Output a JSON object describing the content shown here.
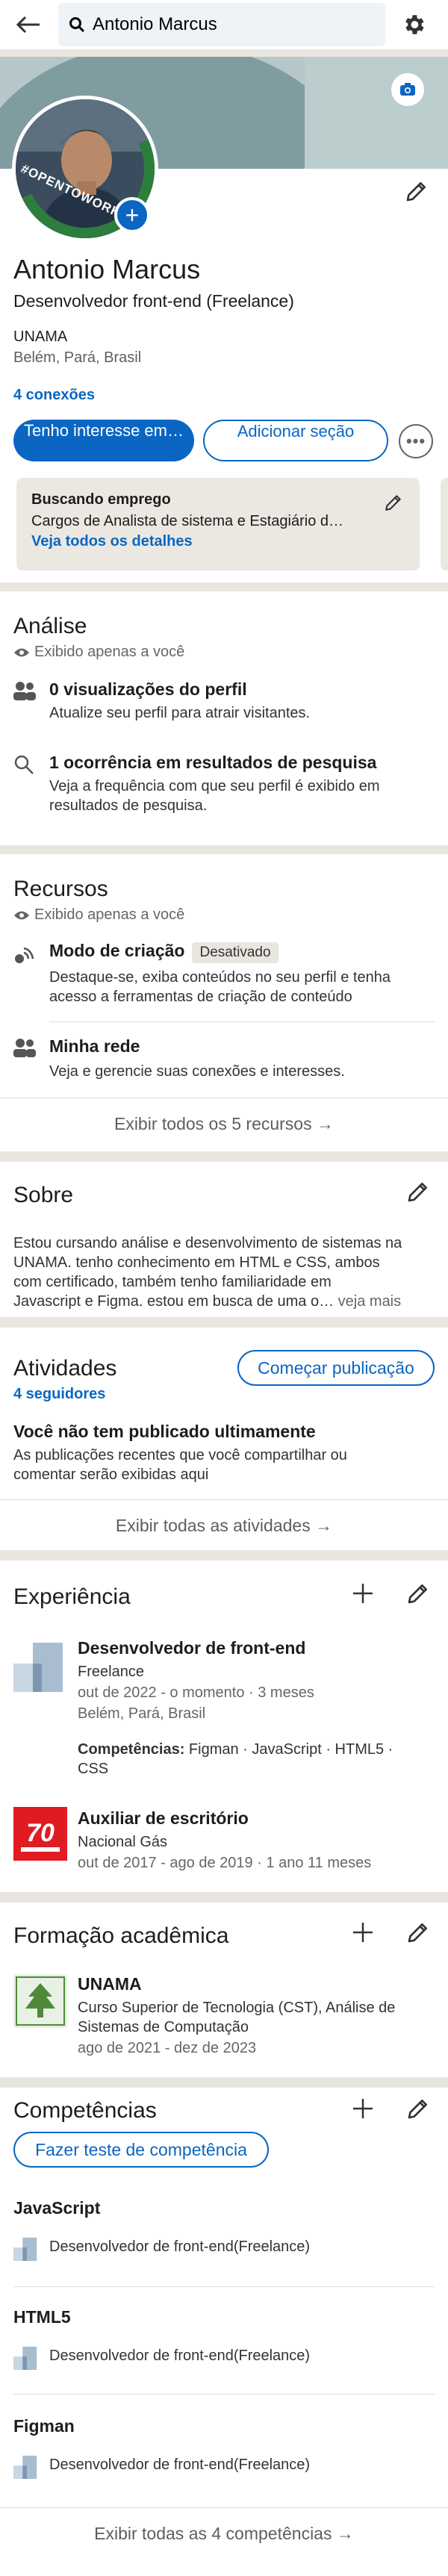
{
  "header": {
    "search_value": "Antonio Marcus"
  },
  "profile": {
    "name": "Antonio Marcus",
    "headline": "Desenvolvedor front-end (Freelance)",
    "school": "UNAMA",
    "location": "Belém, Pará, Brasil",
    "connections": "4 conexões",
    "photo_frame_text": "#OPENTOWORK",
    "btn_primary": "Tenho interesse em…",
    "btn_secondary": "Adicionar seção",
    "btn_more": "•••"
  },
  "open_to_work": {
    "title": "Buscando emprego",
    "desc": "Cargos de Analista de sistema e Estagiário d…",
    "link": "Veja todos os detalhes"
  },
  "analytics": {
    "title": "Análise",
    "private": "Exibido apenas a você",
    "items": [
      {
        "title": "0 visualizações do perfil",
        "desc": "Atualize seu perfil para atrair visitantes."
      },
      {
        "title": "1 ocorrência em resultados de pesquisa",
        "desc1": "Veja a frequência com que seu perfil é exibido em",
        "desc2": "resultados de pesquisa."
      }
    ]
  },
  "resources": {
    "title": "Recursos",
    "private": "Exibido apenas a você",
    "items": [
      {
        "title": "Modo de criação",
        "badge": "Desativado",
        "desc1": "Destaque-se, exiba conteúdos no seu perfil e tenha",
        "desc2": "acesso a ferramentas de criação de conteúdo"
      },
      {
        "title": "Minha rede",
        "desc1": "Veja e gerencie suas conexões e interesses."
      }
    ],
    "show_all": "Exibir todos os 5 recursos →"
  },
  "about": {
    "title": "Sobre",
    "line1": "Estou cursando análise e desenvolvimento de sistemas na",
    "line2": "UNAMA. tenho conhecimento em HTML e CSS, ambos",
    "line3": "com certificado, também tenho familiaridade em",
    "line4": "Javascript e Figma. estou em busca de uma o…",
    "see_more": "veja mais"
  },
  "activity": {
    "title": "Atividades",
    "followers": "4 seguidores",
    "start_post": "Começar publicação",
    "empty_title": "Você não tem publicado ultimamente",
    "empty_desc1": "As publicações recentes que você compartilhar ou",
    "empty_desc2": "comentar serão exibidas aqui",
    "show_all": "Exibir todas as atividades →"
  },
  "experience": {
    "title": "Experiência",
    "items": [
      {
        "title": "Desenvolvedor de front-end",
        "company": "Freelance",
        "dates": "out de 2022 - o momento · 3 meses",
        "location": "Belém, Pará, Brasil",
        "skills_label": "Competências:",
        "skills": " Figman · JavaScript · HTML5 ·",
        "skills2": "CSS"
      },
      {
        "title": "Auxiliar de escritório",
        "company": "Nacional Gás",
        "dates": "out de 2017 - ago de 2019 · 1 ano 11 meses",
        "logo_text": "70"
      }
    ]
  },
  "education": {
    "title": "Formação acadêmica",
    "school": "UNAMA",
    "degree1": "Curso Superior de Tecnologia (CST), Análise de",
    "degree2": "Sistemas de Computação",
    "dates": "ago de 2021 - dez de 2023"
  },
  "skills": {
    "title": "Competências",
    "test_btn": "Fazer teste de competência",
    "items": [
      {
        "name": "JavaScript",
        "source": "Desenvolvedor de front-end(Freelance)"
      },
      {
        "name": "HTML5",
        "source": "Desenvolvedor de front-end(Freelance)"
      },
      {
        "name": "Figman",
        "source": "Desenvolvedor de front-end(Freelance)"
      }
    ],
    "show_all": "Exibir todas as 4 competências →"
  },
  "colors": {
    "accent": "#0a66c2",
    "background": "#e8e6df",
    "open_to_work_green": "#2d7d3d"
  }
}
